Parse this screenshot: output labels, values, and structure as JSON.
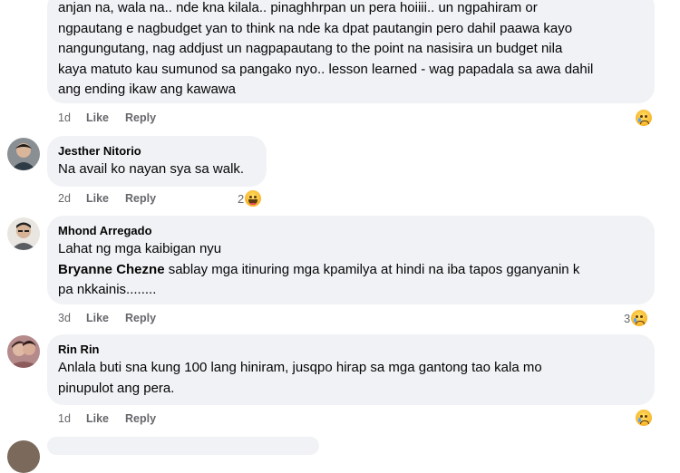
{
  "comments": [
    {
      "text": "anjan na, wala na.. nde kna kilala.. pinaghhrpan un pera hoiiii.. un ngpahiram or ngpautang e nagbudget yan to think na nde ka dpat pautangin pero dahil paawa kayo nangungutang, nag addjust un nagpapautang to the point na nasisira un budget nila kaya matuto kau sumunod sa pangako nyo.. lesson learned - wag papadala sa awa dahil ang ending ikaw ang kawawa",
      "lines": [
        "anjan na, wala na.. nde kna kilala.. pinaghhrpan un pera hoiiii.. un ngpahiram or",
        "ngpautang e nagbudget yan to think na nde ka dpat pautangin pero dahil paawa kayo",
        "nangungutang, nag addjust un nagpapautang to the point na nasisira un budget nila",
        "kaya matuto kau sumunod sa pangako nyo.. lesson learned - wag papadala sa awa dahil",
        "ang ending ikaw ang kawawa"
      ],
      "time": "1d",
      "like_label": "Like",
      "reply_label": "Reply",
      "reaction": {
        "icon": "sad-emoji-icon",
        "count": ""
      }
    },
    {
      "author": "Jesther Nitorio",
      "text": "Na avail ko nayan sya sa walk.",
      "time": "2d",
      "like_label": "Like",
      "reply_label": "Reply",
      "reaction": {
        "icon": "haha-emoji-icon",
        "count": "2"
      }
    },
    {
      "author": "Mhond Arregado",
      "line1": "Lahat ng mga kaibigan nyu",
      "tag": "Bryanne Chezne",
      "tag_text_1": " sablay mga itinuring mga kpamilya at hindi na iba tapos gganyanin k",
      "tag_text_2": "pa nkkainis........",
      "time": "3d",
      "like_label": "Like",
      "reply_label": "Reply",
      "reaction": {
        "icon": "sad-emoji-icon",
        "count": "3"
      }
    },
    {
      "author": "Rin Rin",
      "line1": "Anlala buti sna kung 100 lang hiniram, jusqpo hirap sa mga gantong tao kala mo",
      "line2": "pinupulot ang pera.",
      "time": "1d",
      "like_label": "Like",
      "reply_label": "Reply",
      "reaction": {
        "icon": "sad-emoji-icon",
        "count": ""
      }
    }
  ],
  "colors": {
    "bubble": "#f0f2f5",
    "meta": "#65676b",
    "text": "#050505",
    "emoji": "#f7b125"
  }
}
